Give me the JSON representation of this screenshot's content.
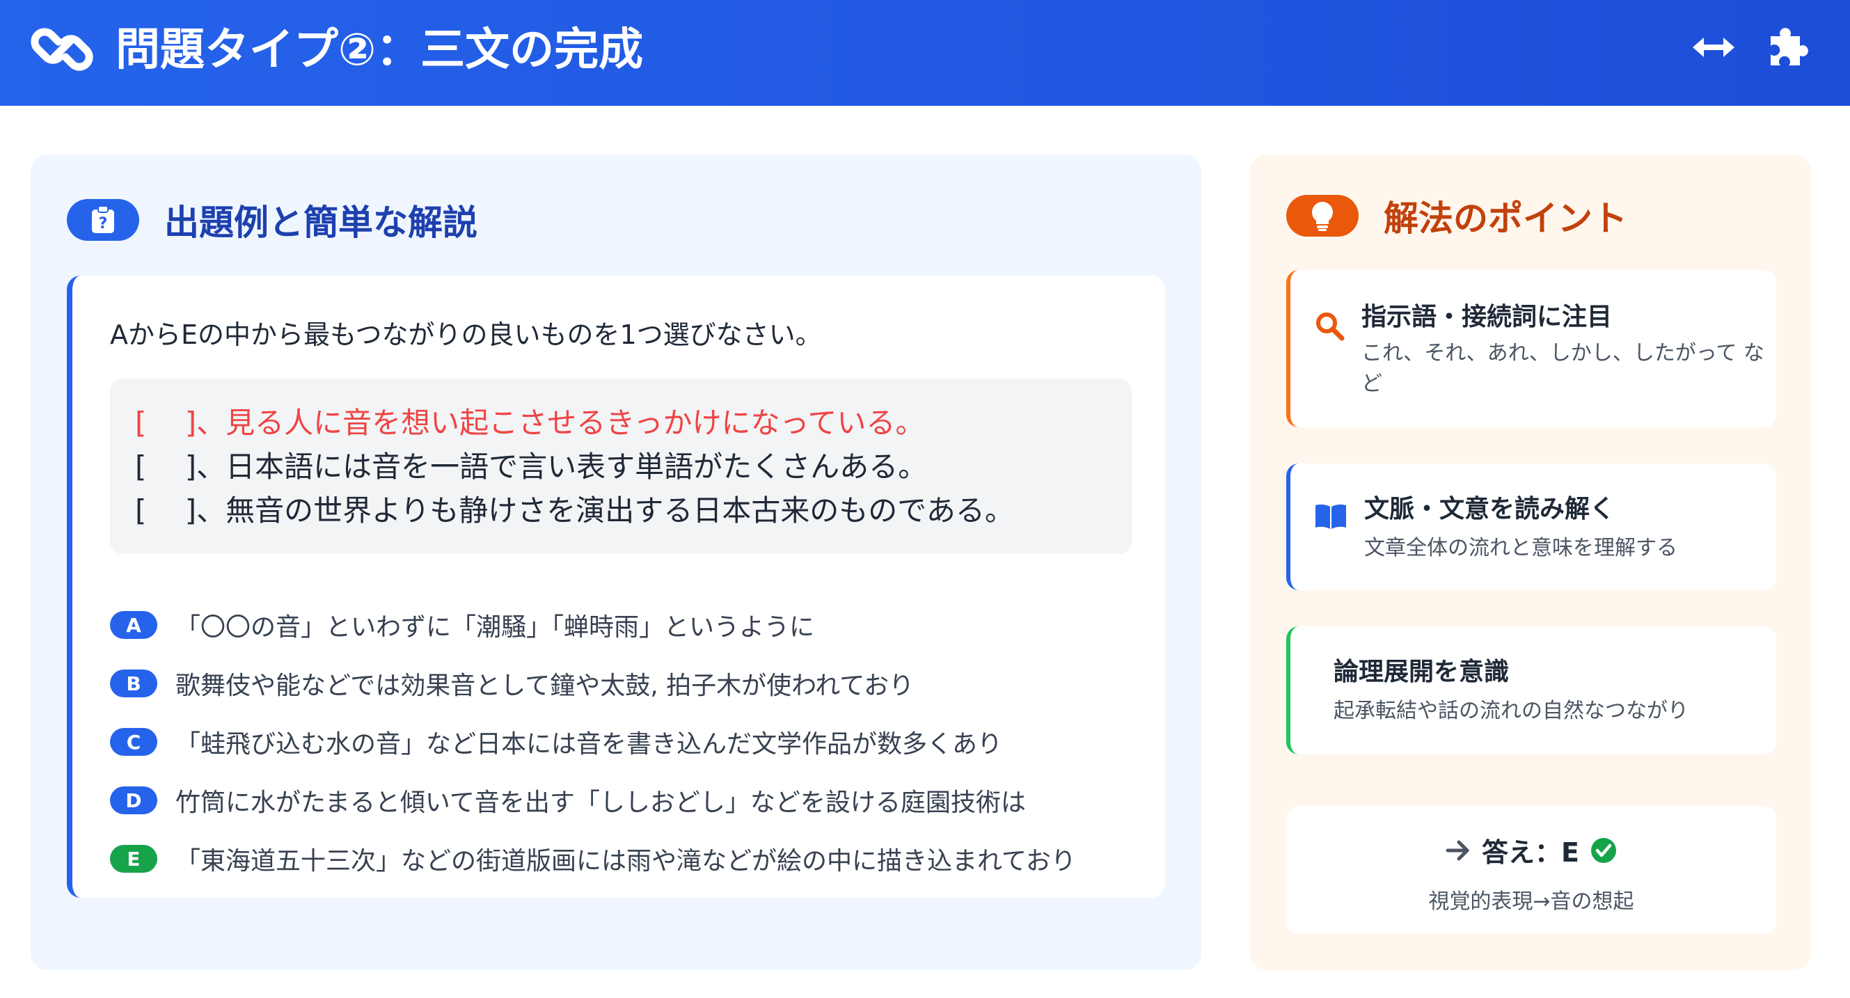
{
  "header": {
    "title": "問題タイプ②：三文の完成",
    "icons": [
      "link-icon",
      "expand-horizontal-icon",
      "puzzle-icon"
    ]
  },
  "example": {
    "section_title": "出題例と簡単な解説",
    "section_icon": "clipboard-question-icon",
    "instruction": "AからEの中から最もつながりの良いものを1つ選びなさい。",
    "blanks": [
      "[　 ]、見る人に音を想い起こさせるきっかけになっている。",
      "[　 ]、日本語には音を一語で言い表す単語がたくさんある。",
      "[　 ]、無音の世界よりも静けさを演出する日本古来のものである。"
    ],
    "choices": [
      {
        "label": "A",
        "text": "「〇〇の音」といわずに「潮騒」「蝉時雨」というように"
      },
      {
        "label": "B",
        "text": "歌舞伎や能などでは効果音として鐘や太鼓, 拍子木が使われており"
      },
      {
        "label": "C",
        "text": "「蛙飛び込む水の音」など日本には音を書き込んだ文学作品が数多くあり"
      },
      {
        "label": "D",
        "text": "竹筒に水がたまると傾いて音を出す「ししおどし」などを設ける庭園技術は"
      },
      {
        "label": "E",
        "text": "「東海道五十三次」などの街道版画には雨や滝などが絵の中に描き込まれており"
      }
    ]
  },
  "points": {
    "section_title": "解法のポイント",
    "section_icon": "lightbulb-icon",
    "items": [
      {
        "title": "指示語・接続詞に注目",
        "desc": "これ、それ、あれ、しかし、したがって など",
        "icon": "search-icon"
      },
      {
        "title": "文脈・文意を読み解く",
        "desc": "文章全体の流れと意味を理解する",
        "icon": "book-icon"
      },
      {
        "title": "論理展開を意識",
        "desc": "起承転結や話の流れの自然なつながり"
      }
    ],
    "answer": {
      "label": "答え：E",
      "note": "視覚的表現→音の想起",
      "icons": [
        "arrow-right-icon",
        "check-circle-icon"
      ]
    }
  },
  "colors": {
    "header_blue": "#2563eb",
    "accent_orange": "#ea580c",
    "highlight_red": "#ef4444",
    "correct_green": "#16a34a"
  }
}
